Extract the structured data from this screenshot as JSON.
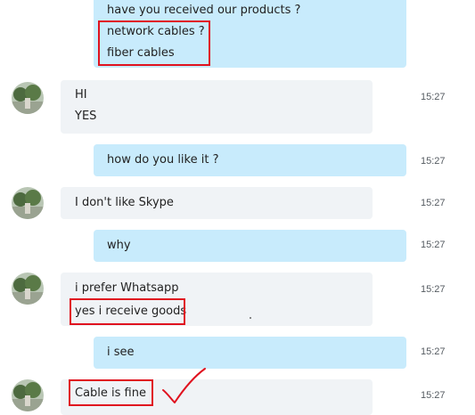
{
  "messages": [
    {
      "lines": [
        "have you received our products ?",
        "network cables ?",
        "fiber cables"
      ]
    },
    {
      "lines": [
        "HI",
        "YES"
      ],
      "time": "15:27"
    },
    {
      "lines": [
        "how do you like it ?"
      ],
      "time": "15:27"
    },
    {
      "lines": [
        "I don't like Skype"
      ],
      "time": "15:27"
    },
    {
      "lines": [
        "why"
      ],
      "time": "15:27"
    },
    {
      "lines": [
        "i prefer Whatsapp",
        "yes i receive goods"
      ],
      "time": "15:27"
    },
    {
      "lines": [
        "i see"
      ],
      "time": "15:27"
    },
    {
      "lines": [
        "Cable is fine"
      ],
      "time": "15:27"
    }
  ],
  "colors": {
    "outgoing_bubble": "#c8ebfc",
    "incoming_bubble": "#f0f3f6",
    "highlight": "#e0121f"
  },
  "icons": {
    "avatar": "contact-avatar-icon",
    "annotation": "checkmark-icon"
  }
}
